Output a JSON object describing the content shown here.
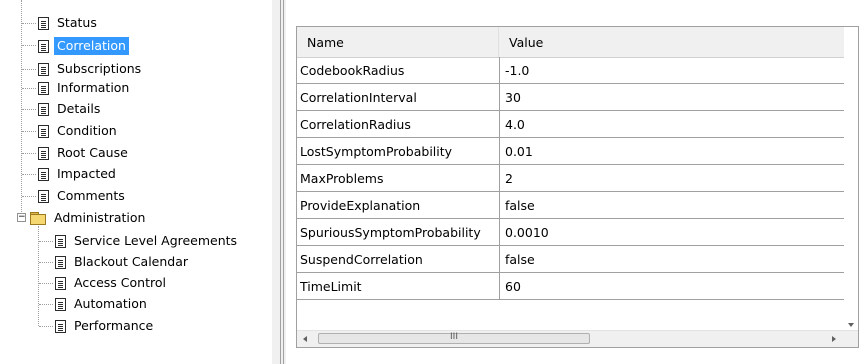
{
  "tree": {
    "items": [
      {
        "label": "Status"
      },
      {
        "label": "Correlation",
        "selected": true
      },
      {
        "label": "Subscriptions"
      },
      {
        "label": "Information"
      },
      {
        "label": "Details"
      },
      {
        "label": "Condition"
      },
      {
        "label": "Root Cause"
      },
      {
        "label": "Impacted"
      },
      {
        "label": "Comments"
      }
    ],
    "admin": {
      "label": "Administration",
      "expander": "−",
      "children": [
        {
          "label": "Service Level Agreements"
        },
        {
          "label": "Blackout Calendar"
        },
        {
          "label": "Access Control"
        },
        {
          "label": "Automation"
        },
        {
          "label": "Performance"
        }
      ]
    }
  },
  "table": {
    "headers": {
      "name": "Name",
      "value": "Value"
    },
    "rows": [
      {
        "name": "CodebookRadius",
        "value": "-1.0"
      },
      {
        "name": "CorrelationInterval",
        "value": "30"
      },
      {
        "name": "CorrelationRadius",
        "value": "4.0"
      },
      {
        "name": "LostSymptomProbability",
        "value": "0.01"
      },
      {
        "name": "MaxProblems",
        "value": "2"
      },
      {
        "name": "ProvideExplanation",
        "value": "false"
      },
      {
        "name": "SpuriousSymptomProbability",
        "value": "0.0010"
      },
      {
        "name": "SuspendCorrelation",
        "value": "false"
      },
      {
        "name": "TimeLimit",
        "value": "60"
      }
    ]
  },
  "scrollbar": {
    "thumb_grip": "III"
  },
  "colors": {
    "selection": "#3399ff",
    "header_bg": "#f0f0f0",
    "grid": "#a0a0a0"
  }
}
